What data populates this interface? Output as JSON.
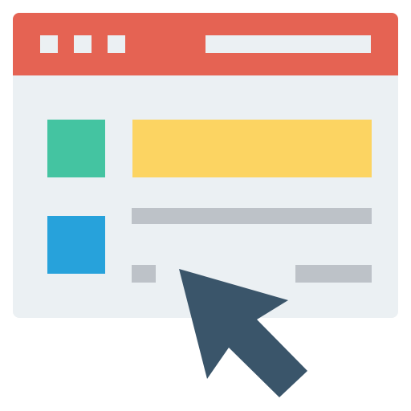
{
  "colors": {
    "titlebar": "#e56353",
    "window_bg": "#ebf0f3",
    "tile_green": "#44c4a1",
    "tile_blue": "#27a2db",
    "bar_yellow": "#fcd462",
    "bar_gray": "#bdc2c8",
    "cursor": "#3a556a"
  },
  "icons": {
    "cursor": "mouse-pointer-icon",
    "window": "browser-window-icon"
  }
}
